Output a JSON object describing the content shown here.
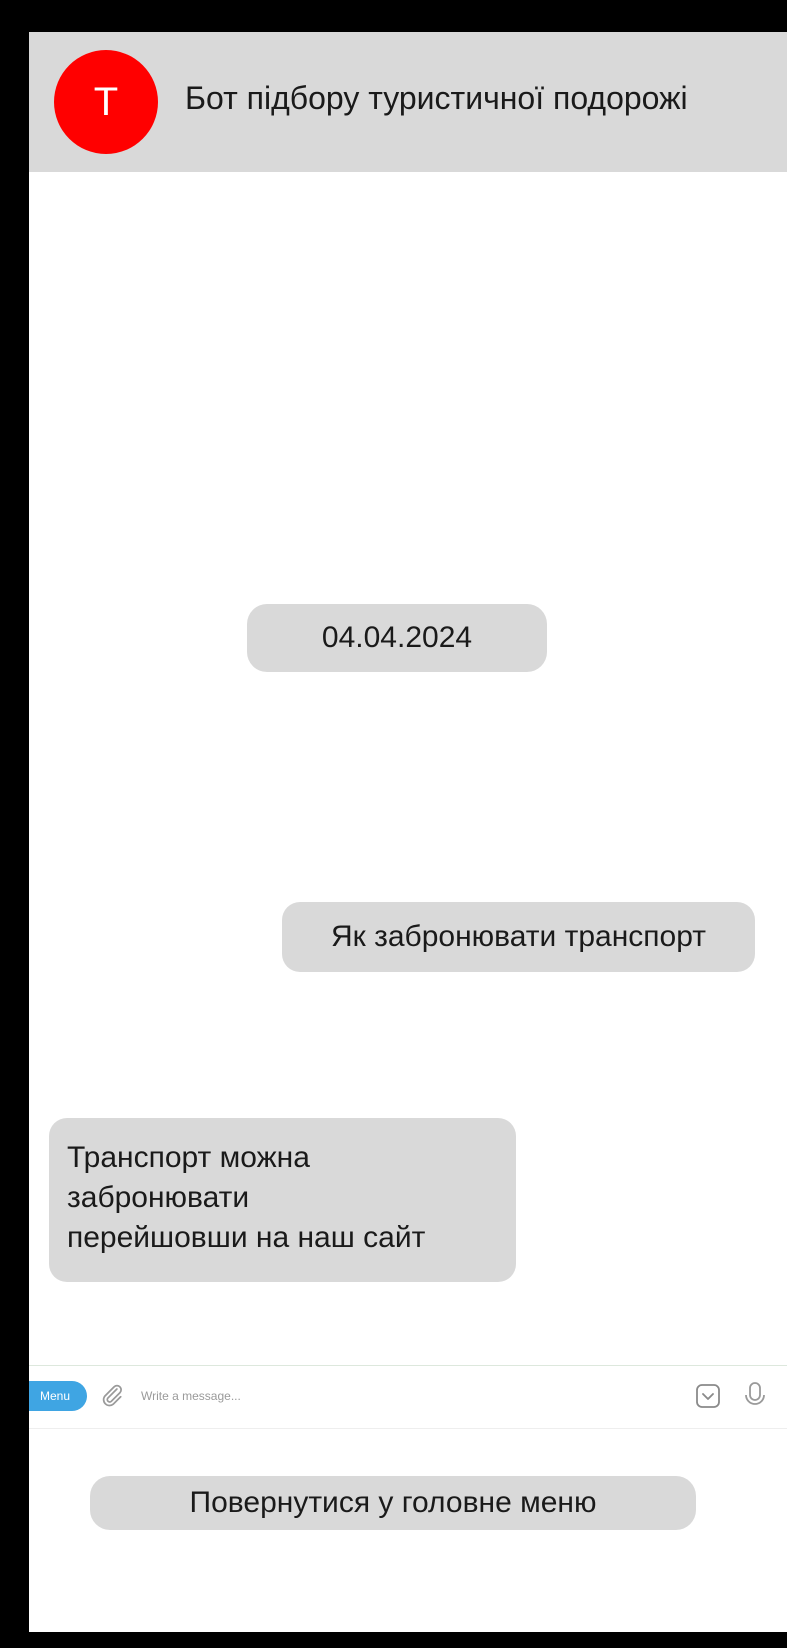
{
  "header": {
    "avatar_letter": "T",
    "title": "Бот підбору туристичної подорожі"
  },
  "chat": {
    "date": "04.04.2024",
    "outgoing_message": "Як забронювати транспорт",
    "incoming_message_lines": [
      "Транспорт можна",
      "забронювати",
      "перейшовши на наш сайт"
    ]
  },
  "input_bar": {
    "menu_label": "Menu",
    "placeholder": "Write a message...",
    "icons": [
      "attach-icon",
      "keyboard-icon",
      "microphone-icon"
    ]
  },
  "footer": {
    "main_menu_label": "Повернутися у головне меню"
  },
  "colors": {
    "avatar": "#ff0000",
    "header_bg": "#d9d9d9",
    "bubble_bg": "#d9d9d9",
    "menu_pill": "#3fa5e3",
    "frame": "#000000"
  }
}
